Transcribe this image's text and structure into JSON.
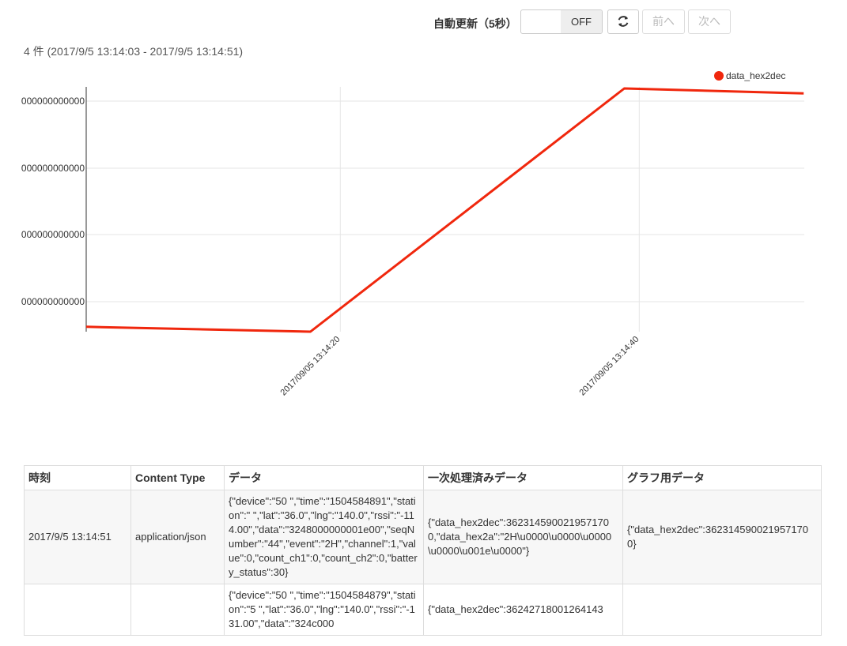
{
  "toolbar": {
    "auto_update_label": "自動更新（5秒）",
    "toggle_state": "OFF",
    "prev_label": "前へ",
    "next_label": "次へ"
  },
  "summary": "4 件 (2017/9/5 13:14:03 - 2017/9/5 13:14:51)",
  "colors": {
    "series": "#f0270d",
    "grid": "#e6e6e6",
    "axis": "#333333"
  },
  "chart_data": {
    "type": "line",
    "title": "",
    "xlabel": "",
    "ylabel": "",
    "x_tick_labels": [
      "2017/09/05 13:14:20",
      "2017/09/05 13:14:40"
    ],
    "y_tick_labels": [
      "000000000000",
      "000000000000",
      "000000000000",
      "000000000000"
    ],
    "grid": true,
    "legend": "top-right",
    "series": [
      {
        "name": "data_hex2dec",
        "x": [
          "2017/09/05 13:14:03",
          "2017/09/05 13:14:18",
          "2017/09/05 13:14:39",
          "2017/09/05 13:14:51"
        ],
        "y": [
          0.02,
          0.0,
          1.0,
          0.98
        ]
      }
    ]
  },
  "table": {
    "headers": [
      "時刻",
      "Content Type",
      "データ",
      "一次処理済みデータ",
      "グラフ用データ"
    ],
    "rows": [
      {
        "time": "2017/9/5 13:14:51",
        "content_type": "application/json",
        "data": "{\"device\":\"50     \",\"time\":\"1504584891\",\"station\":\"     \",\"lat\":\"36.0\",\"lng\":\"140.0\",\"rssi\":\"-114.00\",\"data\":\"3248000000001e00\",\"seqNumber\":\"44\",\"event\":\"2H\",\"channel\":1,\"value\":0,\"count_ch1\":0,\"count_ch2\":0,\"battery_status\":30}",
        "processed": "{\"data_hex2dec\":3623145900219571700,\"data_hex2a\":\"2H\\u0000\\u0000\\u0000\\u0000\\u001e\\u0000\"}",
        "graph": "{\"data_hex2dec\":3623145900219571700}"
      },
      {
        "time": "",
        "content_type": "",
        "data": "{\"device\":\"50     \",\"time\":\"1504584879\",\"station\":\"5    \",\"lat\":\"36.0\",\"lng\":\"140.0\",\"rssi\":\"-131.00\",\"data\":\"324c000",
        "processed": "{\"data_hex2dec\":36242718001264143",
        "graph": ""
      }
    ]
  }
}
